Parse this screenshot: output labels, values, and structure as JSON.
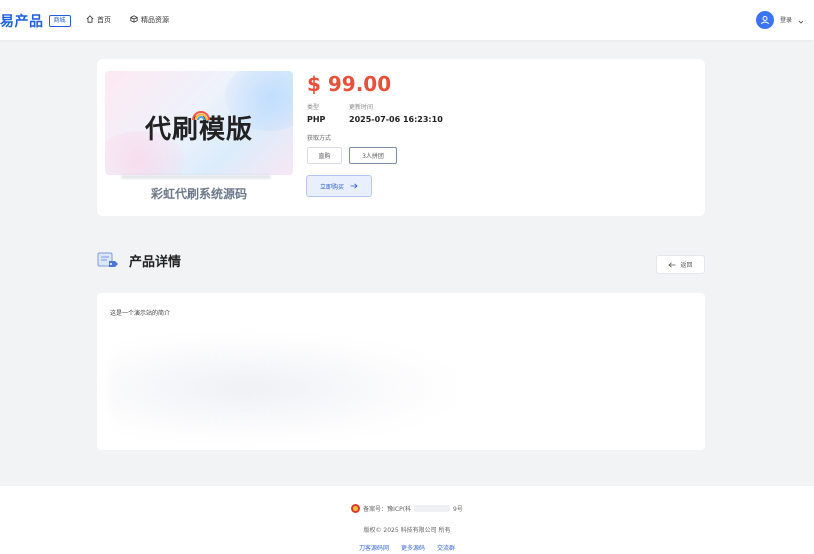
{
  "header": {
    "brand": "易产品",
    "brand_badge": "商城",
    "nav": [
      {
        "label": "首页",
        "icon": "home-icon"
      },
      {
        "label": "精品资源",
        "icon": "box-icon"
      }
    ],
    "user_label": "登录",
    "accent_color": "#1f5fe0"
  },
  "product": {
    "cover_title": "代刷模版",
    "name": "彩虹代刷系统源码",
    "price": "$ 99.00",
    "type_label": "类型",
    "type_value": "PHP",
    "updated_label": "更新时间",
    "updated_value": "2025-07-06 16:23:10",
    "acquire_label": "获取方式",
    "options": [
      "直购",
      "3人拼团"
    ],
    "buy_label": "立即购买",
    "price_color": "#e8503a"
  },
  "details": {
    "title": "产品详情",
    "back_label": "返回",
    "intro": "这是一个演示站的简介"
  },
  "footer": {
    "icp_prefix": "备案号：豫ICP(科",
    "icp_suffix": "9号",
    "copyright": "版权© 2025 科技有限公司 所有",
    "links": [
      "刀客源码网",
      "更多源码",
      "交流群"
    ]
  }
}
